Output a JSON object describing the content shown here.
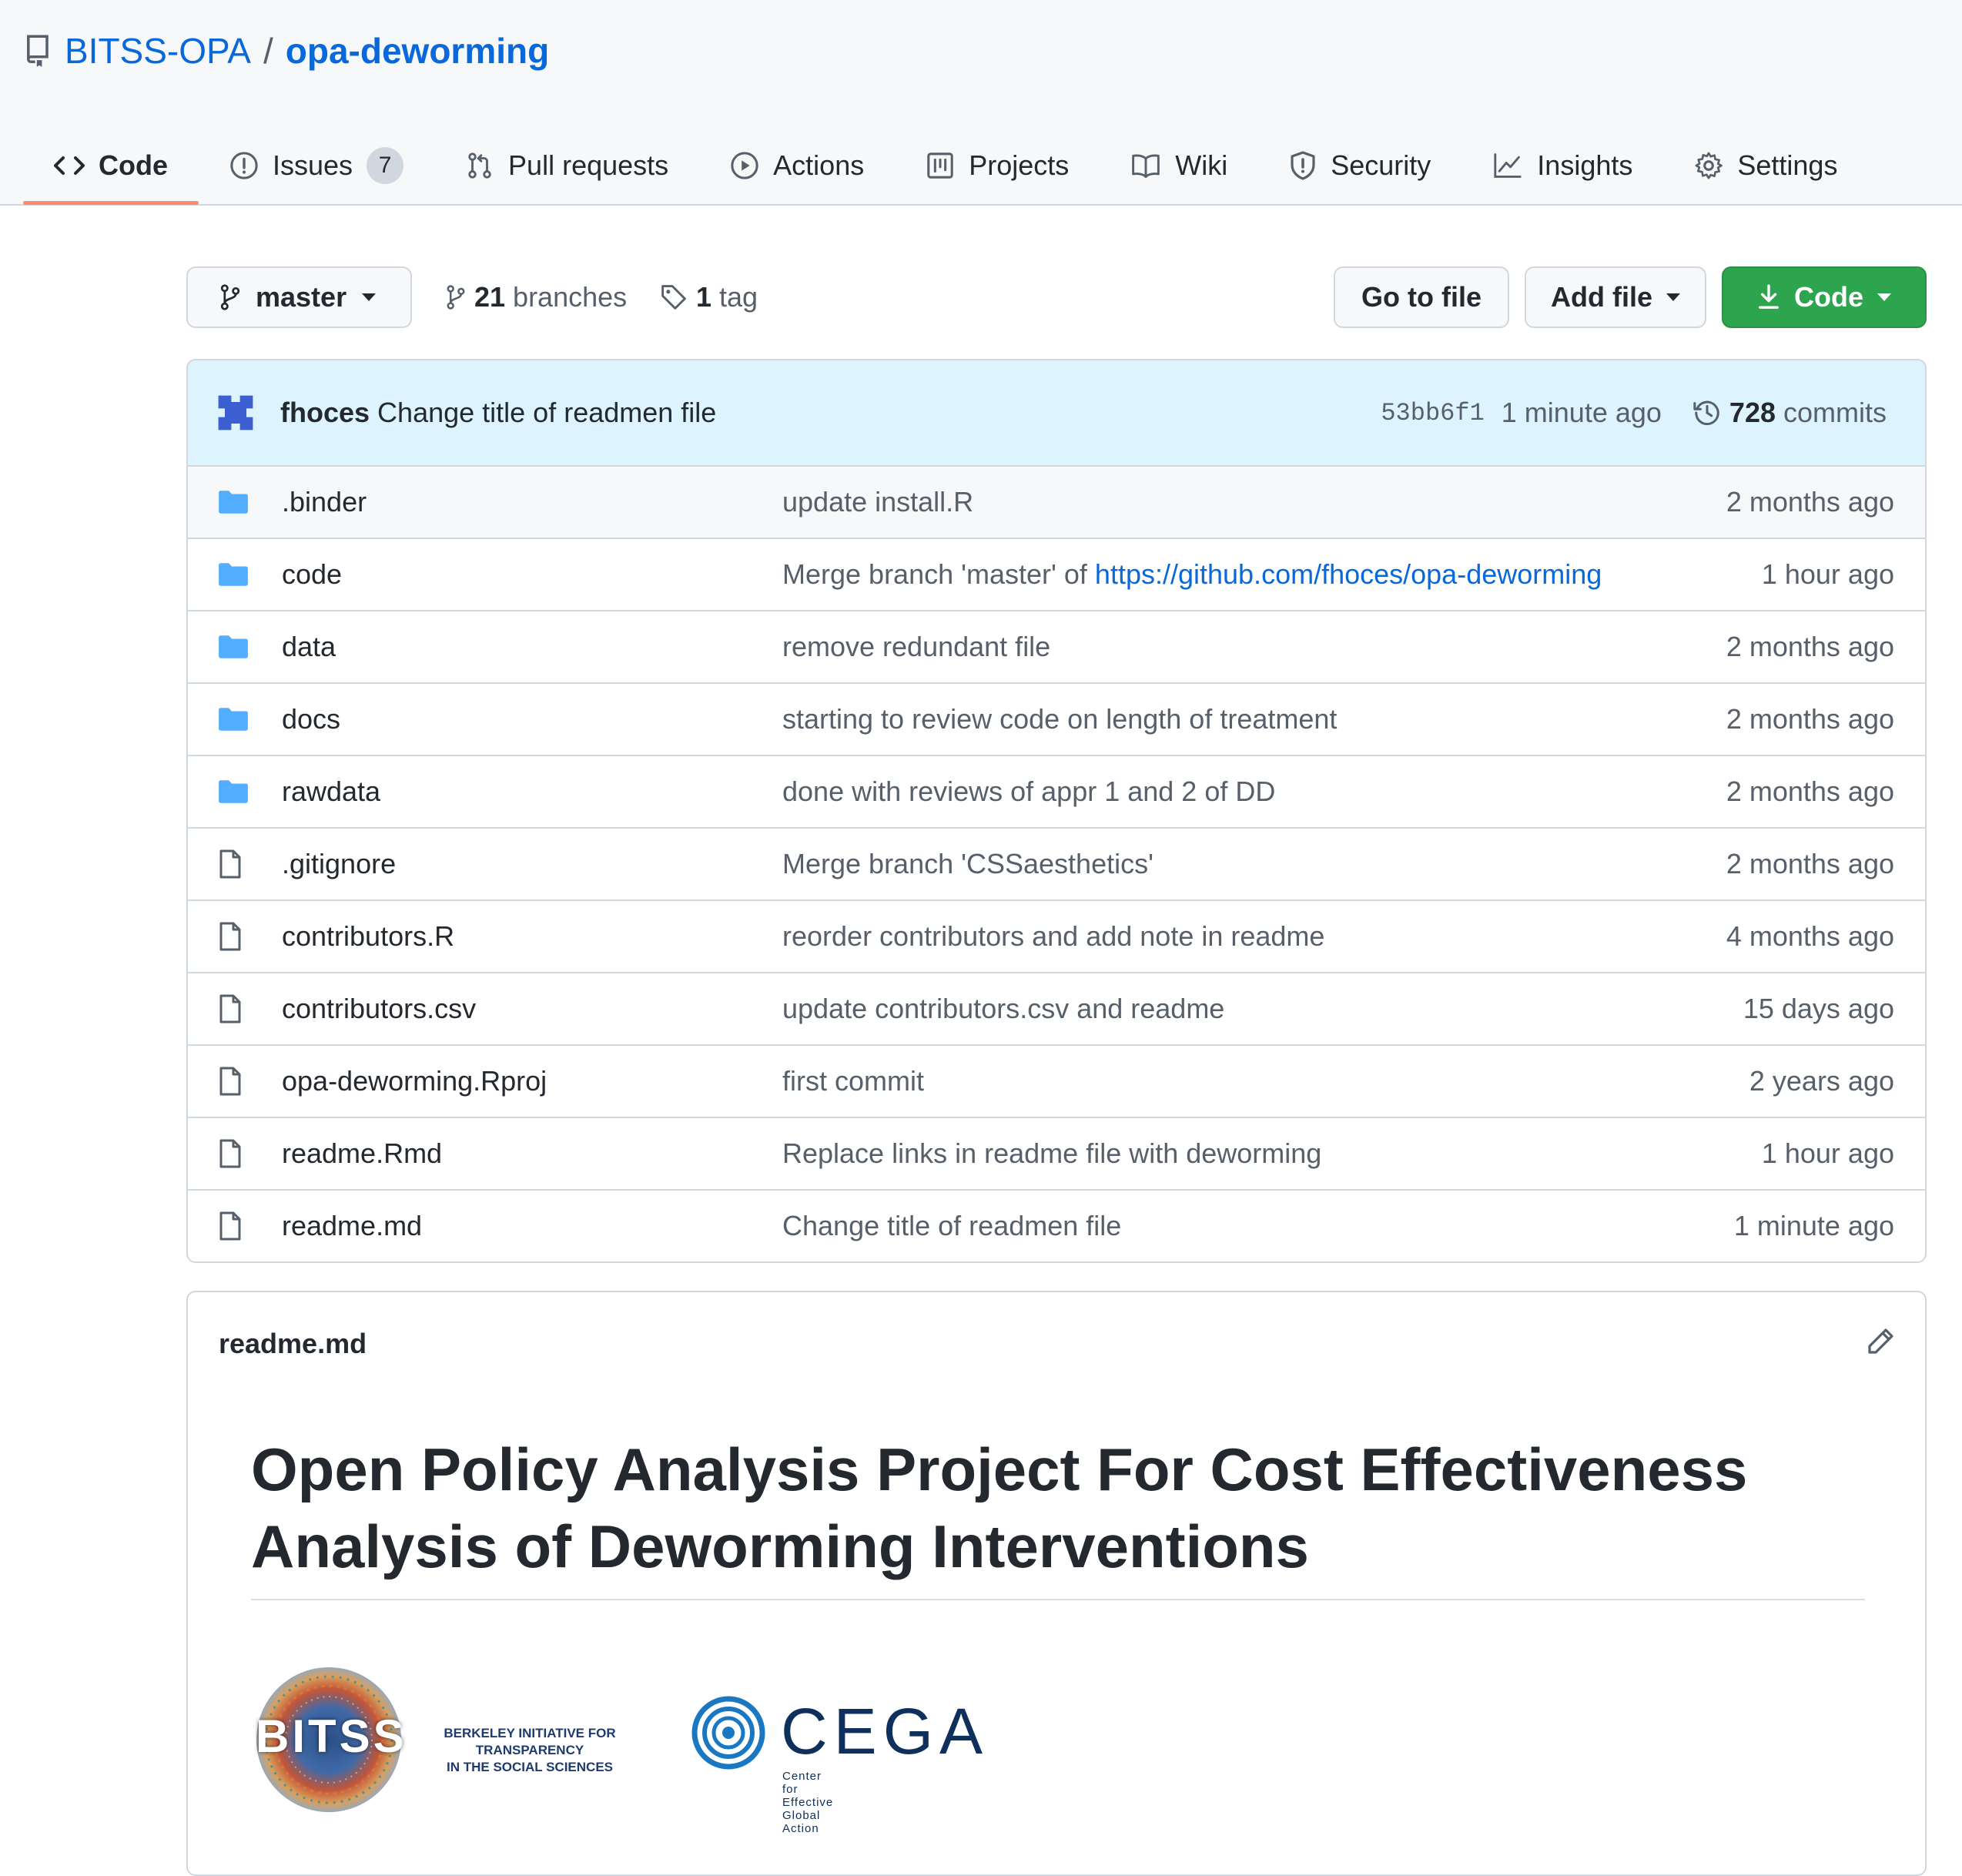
{
  "repo": {
    "owner": "BITSS-OPA",
    "separator": "/",
    "name": "opa-deworming"
  },
  "tabs": [
    {
      "label": "Code",
      "icon": "code-icon",
      "selected": true
    },
    {
      "label": "Issues",
      "icon": "issue-opened-icon",
      "count": "7"
    },
    {
      "label": "Pull requests",
      "icon": "git-pull-request-icon"
    },
    {
      "label": "Actions",
      "icon": "play-icon"
    },
    {
      "label": "Projects",
      "icon": "project-icon"
    },
    {
      "label": "Wiki",
      "icon": "book-icon"
    },
    {
      "label": "Security",
      "icon": "shield-icon"
    },
    {
      "label": "Insights",
      "icon": "graph-icon"
    },
    {
      "label": "Settings",
      "icon": "gear-icon"
    }
  ],
  "toolbar": {
    "branch": "master",
    "branches_count": "21",
    "branches_label": "branches",
    "tags_count": "1",
    "tags_label": "tag",
    "go_to_file": "Go to file",
    "add_file": "Add file",
    "code": "Code"
  },
  "latest_commit": {
    "author": "fhoces",
    "message": "Change title of readmen file",
    "sha": "53bb6f1",
    "time": "1 minute ago",
    "commits_count": "728",
    "commits_label": "commits"
  },
  "files": [
    {
      "type": "dir",
      "name": ".binder",
      "message": "update install.R",
      "age": "2 months ago"
    },
    {
      "type": "dir",
      "name": "code",
      "message": "Merge branch 'master' of ",
      "link": "https://github.com/fhoces/opa-deworming",
      "age": "1 hour ago"
    },
    {
      "type": "dir",
      "name": "data",
      "message": "remove redundant file",
      "age": "2 months ago"
    },
    {
      "type": "dir",
      "name": "docs",
      "message": "starting to review code on length of treatment",
      "age": "2 months ago"
    },
    {
      "type": "dir",
      "name": "rawdata",
      "message": "done with reviews of appr 1 and 2 of DD",
      "age": "2 months ago"
    },
    {
      "type": "file",
      "name": ".gitignore",
      "message": "Merge branch 'CSSaesthetics'",
      "age": "2 months ago"
    },
    {
      "type": "file",
      "name": "contributors.R",
      "message": "reorder contributors and add note in readme",
      "age": "4 months ago"
    },
    {
      "type": "file",
      "name": "contributors.csv",
      "message": "update contributors.csv and readme",
      "age": "15 days ago"
    },
    {
      "type": "file",
      "name": "opa-deworming.Rproj",
      "message": "first commit",
      "age": "2 years ago"
    },
    {
      "type": "file",
      "name": "readme.Rmd",
      "message": "Replace links in readme file with deworming",
      "age": "1 hour ago"
    },
    {
      "type": "file",
      "name": "readme.md",
      "message": "Change title of readmen file",
      "age": "1 minute ago"
    }
  ],
  "readme": {
    "filename": "readme.md",
    "title_line1": "Open Policy Analysis Project For Cost Effectiveness",
    "title_line2": "Analysis of Deworming Interventions",
    "logos": {
      "bitss_word": "BITSS",
      "bitss_tagline_1": "BERKELEY INITIATIVE FOR TRANSPARENCY",
      "bitss_tagline_2": "IN THE SOCIAL SCIENCES",
      "cega_word": "CEGA",
      "cega_tagline": "Center for Effective Global Action"
    }
  },
  "colors": {
    "link": "#0969da",
    "primary_button": "#2da44e",
    "selected_tab_underline": "#fd8c73",
    "folder": "#54aeff"
  }
}
